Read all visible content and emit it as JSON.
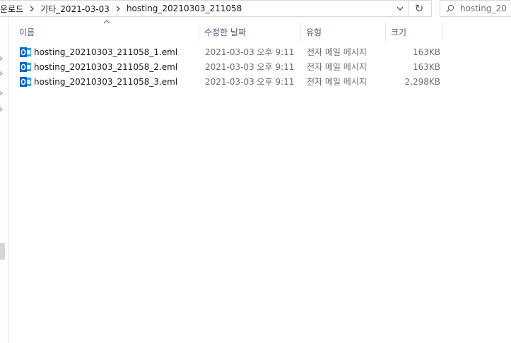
{
  "address": {
    "breadcrumbs": [
      "운로드",
      "기타_2021-03-03",
      "hosting_20210303_211058"
    ],
    "separator_icon": "chevron-right-icon",
    "dropdown_icon": "chevron-down-icon",
    "refresh_symbol": "↻"
  },
  "search": {
    "placeholder": "hosting_20"
  },
  "columns": {
    "name": "이름",
    "date": "수정한 날짜",
    "type": "유형",
    "size": "크기"
  },
  "files": [
    {
      "name": "hosting_20210303_211058_1.eml",
      "date": "2021-03-03 오후 9:11",
      "type": "전자 메일 메시지",
      "size": "163KB"
    },
    {
      "name": "hosting_20210303_211058_2.eml",
      "date": "2021-03-03 오후 9:11",
      "type": "전자 메일 메시지",
      "size": "163KB"
    },
    {
      "name": "hosting_20210303_211058_3.eml",
      "date": "2021-03-03 오후 9:11",
      "type": "전자 메일 메시지",
      "size": "2,298KB"
    }
  ],
  "colors": {
    "outlook_blue": "#0a64c8",
    "header_text": "#4c607a"
  }
}
